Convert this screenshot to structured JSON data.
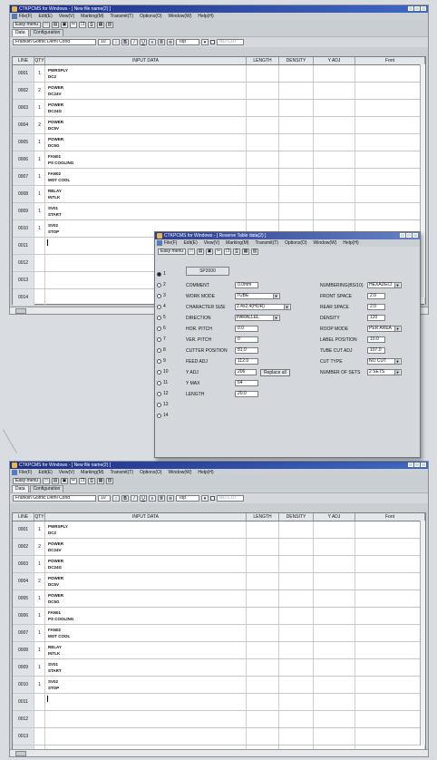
{
  "colors": {
    "titlebar": "#1f2f86",
    "window_bg": "#c9ced3",
    "grid_bg": "#ffffff",
    "line_col_bg": "#dfe3e7"
  },
  "main": {
    "title": "CTKPCMS for Windows - [ New file name(2) ]",
    "menu": [
      "File(F)",
      "Edit(E)",
      "View(V)",
      "Marking(M)",
      "Transmit(T)",
      "Options(O)",
      "Window(W)",
      "Help(H)"
    ],
    "toolbar": {
      "easy_menu": "Easy menu"
    },
    "tabs": [
      "Data",
      "Configuration"
    ],
    "format": {
      "font": "Franklin Gothic Demi Cond",
      "size": "10",
      "align": "Top",
      "cut": "NO CUT"
    },
    "columns": [
      "LINE",
      "QTY",
      "INPUT DATA",
      "LENGTH",
      "DENSITY",
      "Y ADJ",
      "Font"
    ],
    "rows": [
      {
        "line": "0001",
        "qty": "1",
        "lines": [
          "PWRSPLY",
          "DC2"
        ]
      },
      {
        "line": "0002",
        "qty": "2",
        "lines": [
          "POWER",
          "DC24V"
        ]
      },
      {
        "line": "0003",
        "qty": "1",
        "lines": [
          "POWER",
          "DC24G"
        ]
      },
      {
        "line": "0004",
        "qty": "2",
        "lines": [
          "POWER",
          "DC5V"
        ]
      },
      {
        "line": "0005",
        "qty": "1",
        "lines": [
          "POWER",
          "DC5G"
        ]
      },
      {
        "line": "0006",
        "qty": "1",
        "lines": [
          "FAN01",
          "PS COOLING"
        ]
      },
      {
        "line": "0007",
        "qty": "1",
        "lines": [
          "FAN02",
          "MOT COOL"
        ]
      },
      {
        "line": "0008",
        "qty": "1",
        "lines": [
          "RELAY",
          "INTLK"
        ]
      },
      {
        "line": "0009",
        "qty": "1",
        "lines": [
          "SV01",
          "START"
        ]
      },
      {
        "line": "0010",
        "qty": "1",
        "lines": [
          "SV02",
          "STOP"
        ]
      },
      {
        "line": "0011",
        "qty": "",
        "lines": []
      },
      {
        "line": "0012",
        "qty": "",
        "lines": []
      },
      {
        "line": "0013",
        "qty": "",
        "lines": []
      },
      {
        "line": "0014",
        "qty": "",
        "lines": []
      }
    ]
  },
  "popup": {
    "title": "CTKPCMS for Windows - [ Reserve Table data(2) ]",
    "model": "SP2000",
    "radios": [
      "1",
      "2",
      "3",
      "4",
      "5",
      "6",
      "7",
      "8",
      "9",
      "10",
      "11",
      "12",
      "13",
      "14"
    ],
    "left_fields": [
      {
        "label": "COMMENT",
        "value": "0.0mm"
      },
      {
        "label": "WORK MODE",
        "value": "TUBE"
      },
      {
        "label": "CHARACTER SIZE",
        "value": "2.4x2.4(HOR)"
      },
      {
        "label": "DIRECTION",
        "value": "PARALLEL"
      },
      {
        "label": "HOR. PITCH",
        "value": "0.0"
      },
      {
        "label": "VER. PITCH",
        "value": "0"
      },
      {
        "label": "CUTTER POSITION",
        "value": "81.0"
      },
      {
        "label": "FEED ADJ",
        "value": "112.0"
      },
      {
        "label": "Y ADJ",
        "value": "206"
      },
      {
        "label": "Y MAX",
        "value": "64"
      },
      {
        "label": "LENGTH",
        "value": "20.0"
      }
    ],
    "replace_all": "Replace all",
    "right_fields": [
      {
        "label": "NUMBERING(BS/10)",
        "value": "HEXADECI"
      },
      {
        "label": "FRONT SPACE",
        "value": "2.0"
      },
      {
        "label": "REAR SPACE",
        "value": "2.0"
      },
      {
        "label": "DENSITY",
        "value": "120"
      },
      {
        "label": "ROOP MODE",
        "value": "PER AREA"
      },
      {
        "label": "LABEL POSITION",
        "value": "10.0"
      },
      {
        "label": "TUBE CUT ADJ",
        "value": "107.0"
      },
      {
        "label": "CUT TYPE",
        "value": "NO CUT"
      },
      {
        "label": "NUMBER OF SETS",
        "value": "2 SETS"
      }
    ]
  },
  "icons": [
    "app-icon",
    "open-icon",
    "save-icon",
    "print-icon",
    "bold-icon",
    "italic-icon",
    "underline-icon",
    "align-icon"
  ]
}
